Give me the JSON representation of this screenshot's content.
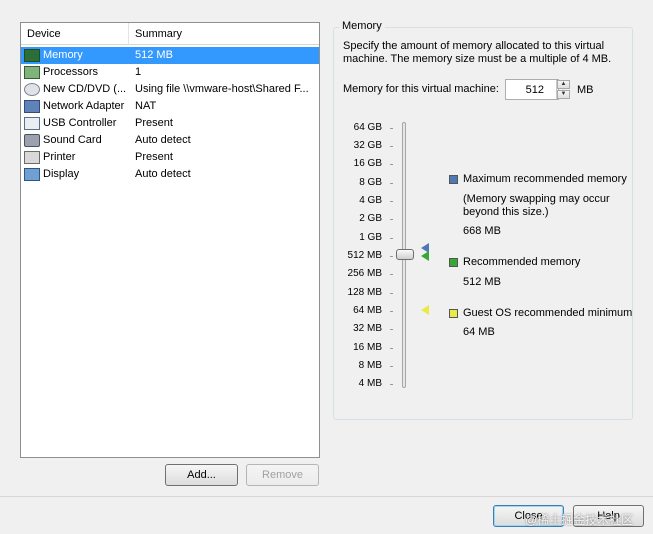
{
  "device_list": {
    "columns": [
      "Device",
      "Summary"
    ],
    "rows": [
      {
        "icon": "memory-icon",
        "name": "Memory",
        "summary": "512 MB",
        "selected": true
      },
      {
        "icon": "processors-icon",
        "name": "Processors",
        "summary": "1"
      },
      {
        "icon": "cd-dvd-icon",
        "name": "New CD/DVD (...",
        "summary": "Using file \\\\vmware-host\\Shared F..."
      },
      {
        "icon": "network-adapter-icon",
        "name": "Network Adapter",
        "summary": "NAT"
      },
      {
        "icon": "usb-controller-icon",
        "name": "USB Controller",
        "summary": "Present"
      },
      {
        "icon": "sound-card-icon",
        "name": "Sound Card",
        "summary": "Auto detect"
      },
      {
        "icon": "printer-icon",
        "name": "Printer",
        "summary": "Present"
      },
      {
        "icon": "display-icon",
        "name": "Display",
        "summary": "Auto detect"
      }
    ],
    "add_label": "Add...",
    "remove_label": "Remove"
  },
  "memory_panel": {
    "title": "Memory",
    "description": "Specify the amount of memory allocated to this virtual machine. The memory size must be a multiple of 4 MB.",
    "field_label": "Memory for this virtual machine:",
    "value": "512",
    "unit": "MB",
    "scale": [
      "64 GB",
      "32 GB",
      "16 GB",
      "8 GB",
      "4 GB",
      "2 GB",
      "1 GB",
      "512 MB",
      "256 MB",
      "128 MB",
      "64 MB",
      "32 MB",
      "16 MB",
      "8 MB",
      "4 MB"
    ],
    "slider_value": "512 MB",
    "legend": {
      "max_title": "Maximum recommended memory",
      "max_note": "(Memory swapping may occur beyond this size.)",
      "max_value": "668 MB",
      "rec_title": "Recommended memory",
      "rec_value": "512 MB",
      "min_title": "Guest OS recommended minimum",
      "min_value": "64 MB"
    },
    "colors": {
      "max": "#4f79b5",
      "recommended": "#3aa636",
      "minimum": "#e9e94a"
    }
  },
  "footer": {
    "close_label": "Close",
    "help_label": "Help",
    "watermark": "@稀土掘金技术社区"
  }
}
